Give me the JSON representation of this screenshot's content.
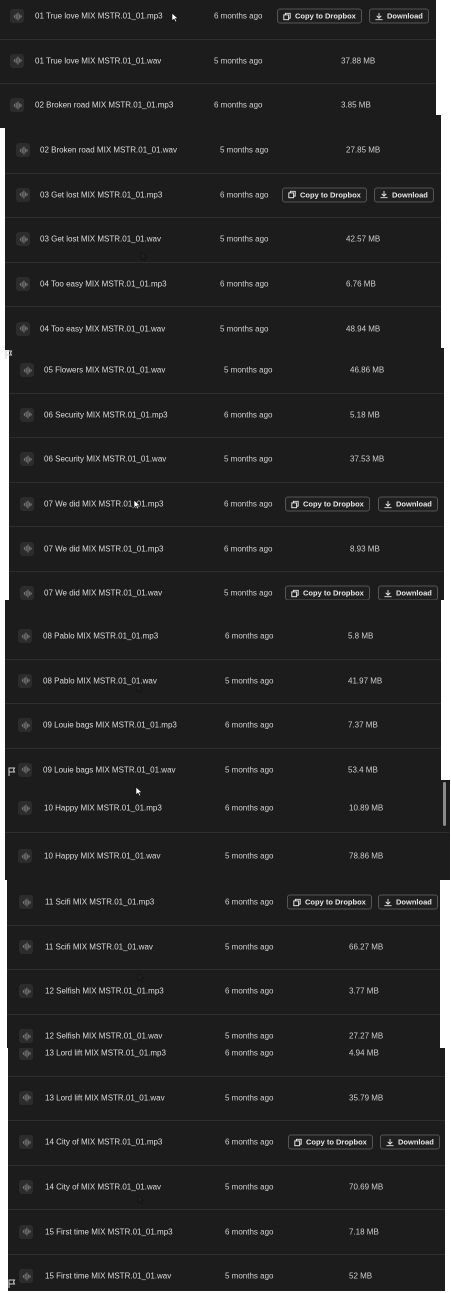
{
  "labels": {
    "copy_to_dropbox": "Copy to Dropbox",
    "download": "Download"
  },
  "panels": [
    {
      "rows": [
        {
          "name": "01 True love MIX MSTR.01_01.mp3",
          "modified": "6 months ago",
          "size": "",
          "hover": true
        },
        {
          "name": "01 True love MIX MSTR.01_01.wav",
          "modified": "5 months ago",
          "size": "37.88 MB",
          "hover": false
        },
        {
          "name": "02 Broken road MIX MSTR.01_01.mp3",
          "modified": "6 months ago",
          "size": "3.85 MB",
          "hover": false
        }
      ]
    },
    {
      "rows": [
        {
          "name": "02 Broken road MIX MSTR.01_01.wav",
          "modified": "5 months ago",
          "size": "27.85 MB",
          "hover": false
        },
        {
          "name": "03 Get lost MIX MSTR.01_01.mp3",
          "modified": "6 months ago",
          "size": "",
          "hover": true
        },
        {
          "name": "03 Get lost MIX MSTR.01_01.wav",
          "modified": "5 months ago",
          "size": "42.57 MB",
          "hover": false
        },
        {
          "name": "04 Too easy MIX MSTR.01_01.mp3",
          "modified": "6 months ago",
          "size": "6.76 MB",
          "hover": false
        },
        {
          "name": "04 Too easy MIX MSTR.01_01.wav",
          "modified": "5 months ago",
          "size": "48.94 MB",
          "hover": false
        }
      ]
    },
    {
      "rows": [
        {
          "name": "05 Flowers MIX MSTR.01_01.wav",
          "modified": "5 months ago",
          "size": "46.86 MB",
          "hover": false
        },
        {
          "name": "06 Security MIX MSTR.01_01.mp3",
          "modified": "6 months ago",
          "size": "5.18 MB",
          "hover": false
        },
        {
          "name": "06 Security MIX MSTR.01_01.wav",
          "modified": "5 months ago",
          "size": "37.53 MB",
          "hover": false
        },
        {
          "name": "07 We did MIX MSTR.01_01.mp3",
          "modified": "6 months ago",
          "size": "",
          "hover": true
        },
        {
          "name": "07 We did MIX MSTR.01_01.mp3",
          "modified": "6 months ago",
          "size": "8.93 MB",
          "hover": false
        },
        {
          "name": "07 We did MIX MSTR.01_01.wav",
          "modified": "5 months ago",
          "size": "",
          "hover": true
        }
      ]
    },
    {
      "rows": [
        {
          "name": "08 Pablo MIX MSTR.01_01.mp3",
          "modified": "6 months ago",
          "size": "5.8 MB",
          "hover": false
        },
        {
          "name": "08 Pablo MIX MSTR.01_01.wav",
          "modified": "5 months ago",
          "size": "41.97 MB",
          "hover": false
        },
        {
          "name": "09 Louie bags MIX MSTR.01_01.mp3",
          "modified": "6 months ago",
          "size": "7.37 MB",
          "hover": false
        },
        {
          "name": "09 Louie bags MIX MSTR.01_01.wav",
          "modified": "5 months ago",
          "size": "53.4 MB",
          "hover": false
        }
      ]
    },
    {
      "rows": [
        {
          "name": "10 Happy MIX MSTR.01_01.mp3",
          "modified": "6 months ago",
          "size": "10.89 MB",
          "hover": false
        },
        {
          "name": "10 Happy MIX MSTR.01_01.wav",
          "modified": "5 months ago",
          "size": "78.86 MB",
          "hover": false
        }
      ]
    },
    {
      "rows": [
        {
          "name": "11 Scifi MIX MSTR.01_01.mp3",
          "modified": "6 months ago",
          "size": "",
          "hover": true
        },
        {
          "name": "11 Scifi MIX MSTR.01_01.wav",
          "modified": "5 months ago",
          "size": "66.27 MB",
          "hover": false
        },
        {
          "name": "12 Selfish MIX MSTR.01_01.mp3",
          "modified": "6 months ago",
          "size": "3.77 MB",
          "hover": false
        },
        {
          "name": "12 Selfish MIX MSTR.01_01.wav",
          "modified": "5 months ago",
          "size": "27.27 MB",
          "hover": false
        }
      ]
    },
    {
      "rows": [
        {
          "name": "13 Lord lift MIX MSTR.01_01.mp3",
          "modified": "6 months ago",
          "size": "4.94 MB",
          "hover": false
        },
        {
          "name": "13 Lord lift MIX MSTR.01_01.wav",
          "modified": "5 months ago",
          "size": "35.79 MB",
          "hover": false
        },
        {
          "name": "14 City of MIX MSTR.01_01.mp3",
          "modified": "6 months ago",
          "size": "",
          "hover": true
        },
        {
          "name": "14 City of MIX MSTR.01_01.wav",
          "modified": "5 months ago",
          "size": "70.69 MB",
          "hover": false
        },
        {
          "name": "15 First time MIX MSTR.01_01.mp3",
          "modified": "6 months ago",
          "size": "7.18 MB",
          "hover": false
        },
        {
          "name": "15 First time MIX MSTR.01_01.wav",
          "modified": "5 months ago",
          "size": "52 MB",
          "hover": false
        }
      ]
    }
  ]
}
